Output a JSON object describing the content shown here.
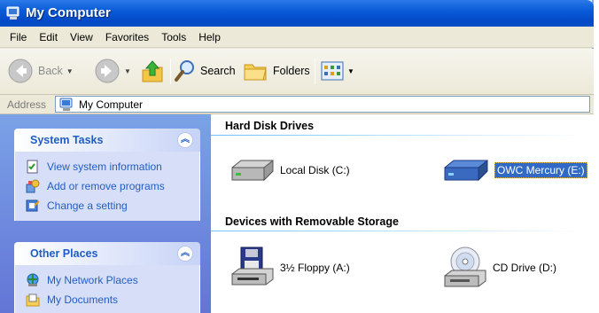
{
  "window": {
    "title": "My Computer"
  },
  "menu": [
    "File",
    "Edit",
    "View",
    "Favorites",
    "Tools",
    "Help"
  ],
  "toolbar": {
    "back_label": "Back",
    "search_label": "Search",
    "folders_label": "Folders"
  },
  "address": {
    "label": "Address",
    "value": "My Computer"
  },
  "system_tasks": {
    "title": "System Tasks",
    "items": [
      "View system information",
      "Add or remove programs",
      "Change a setting"
    ]
  },
  "other_places": {
    "title": "Other Places",
    "items": [
      "My Network Places",
      "My Documents"
    ]
  },
  "hard_disks": {
    "title": "Hard Disk Drives",
    "items": [
      "Local Disk (C:)",
      "OWC Mercury (E:)"
    ]
  },
  "removable": {
    "title": "Devices with Removable Storage",
    "items": [
      "3½ Floppy (A:)",
      "CD Drive (D:)"
    ]
  },
  "colors": {
    "titlebar": "#0a5bd8",
    "taskpane": "#6f8fe0",
    "link": "#215dc6",
    "selection": "#316ac5"
  }
}
